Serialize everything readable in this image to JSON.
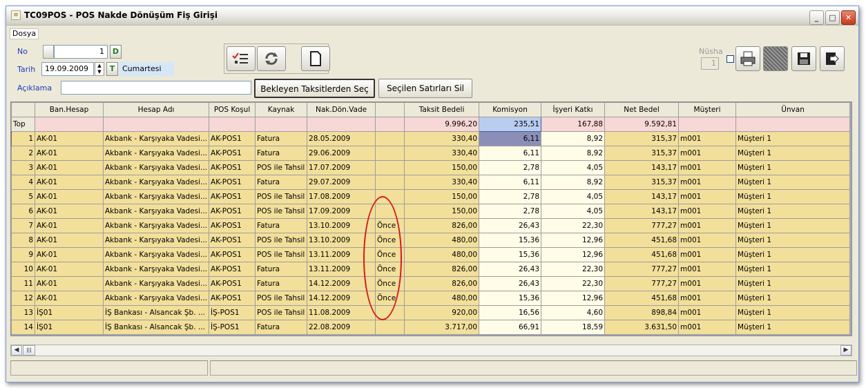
{
  "window": {
    "title": "TC09POS - POS Nakde Dönüşüm Fiş Girişi",
    "app_icon": "document-icon",
    "controls": {
      "minimize": "_",
      "maximize": "□",
      "close": "✕"
    }
  },
  "menu": {
    "items": [
      "Dosya"
    ]
  },
  "form": {
    "no_label": "No",
    "no_value": "1",
    "no_button": "D",
    "tarih_label": "Tarih",
    "tarih_value": "19.09.2009",
    "today_button": "T",
    "day_name": "Cumartesi",
    "aciklama_label": "Açıklama",
    "aciklama_value": "",
    "bekleyen_button": "Bekleyen Taksitlerden Seç",
    "secilen_sil_button": "Seçilen Satırları Sil",
    "nusha_label": "Nüsha",
    "nusha_value": "1"
  },
  "toolbar": {
    "left_icons": [
      "checklist-icon",
      "refresh-icon",
      "new-document-icon"
    ],
    "right_icons": [
      "print-icon",
      "grid-icon",
      "save-icon",
      "exit-icon"
    ]
  },
  "grid": {
    "columns": [
      "",
      "Ban.Hesap",
      "Hesap Adı",
      "POS Koşul",
      "Kaynak",
      "Nak.Dön.Vade",
      "",
      "Taksit Bedeli",
      "Komisyon",
      "İşyeri Katkı",
      "Net Bedel",
      "Müşteri",
      "Ünvan"
    ],
    "top_row": {
      "label": "Top",
      "taksit": "9.996,20",
      "komisyon": "235,51",
      "katki": "167,88",
      "net": "9.592,81"
    },
    "rows": [
      [
        "1",
        "AK-01",
        "Akbank - Karşıyaka Vadesi...",
        "AK-POS1",
        "Fatura",
        "28.05.2009",
        "",
        "330,40",
        "6,11",
        "8,92",
        "315,37",
        "m001",
        "Müşteri 1"
      ],
      [
        "2",
        "AK-01",
        "Akbank - Karşıyaka Vadesi...",
        "AK-POS1",
        "Fatura",
        "29.06.2009",
        "",
        "330,40",
        "6,11",
        "8,92",
        "315,37",
        "m001",
        "Müşteri 1"
      ],
      [
        "3",
        "AK-01",
        "Akbank - Karşıyaka Vadesi...",
        "AK-POS1",
        "POS ile Tahsil",
        "17.07.2009",
        "",
        "150,00",
        "2,78",
        "4,05",
        "143,17",
        "m001",
        "Müşteri 1"
      ],
      [
        "4",
        "AK-01",
        "Akbank - Karşıyaka Vadesi...",
        "AK-POS1",
        "Fatura",
        "29.07.2009",
        "",
        "330,40",
        "6,11",
        "8,92",
        "315,37",
        "m001",
        "Müşteri 1"
      ],
      [
        "5",
        "AK-01",
        "Akbank - Karşıyaka Vadesi...",
        "AK-POS1",
        "POS ile Tahsil",
        "17.08.2009",
        "",
        "150,00",
        "2,78",
        "4,05",
        "143,17",
        "m001",
        "Müşteri 1"
      ],
      [
        "6",
        "AK-01",
        "Akbank - Karşıyaka Vadesi...",
        "AK-POS1",
        "POS ile Tahsil",
        "17.09.2009",
        "",
        "150,00",
        "2,78",
        "4,05",
        "143,17",
        "m001",
        "Müşteri 1"
      ],
      [
        "7",
        "AK-01",
        "Akbank - Karşıyaka Vadesi...",
        "AK-POS1",
        "Fatura",
        "13.10.2009",
        "Önce",
        "826,00",
        "26,43",
        "22,30",
        "777,27",
        "m001",
        "Müşteri 1"
      ],
      [
        "8",
        "AK-01",
        "Akbank - Karşıyaka Vadesi...",
        "AK-POS1",
        "POS ile Tahsil",
        "13.10.2009",
        "Önce",
        "480,00",
        "15,36",
        "12,96",
        "451,68",
        "m001",
        "Müşteri 1"
      ],
      [
        "9",
        "AK-01",
        "Akbank - Karşıyaka Vadesi...",
        "AK-POS1",
        "POS ile Tahsil",
        "13.11.2009",
        "Önce",
        "480,00",
        "15,36",
        "12,96",
        "451,68",
        "m001",
        "Müşteri 1"
      ],
      [
        "10",
        "AK-01",
        "Akbank - Karşıyaka Vadesi...",
        "AK-POS1",
        "Fatura",
        "13.11.2009",
        "Önce",
        "826,00",
        "26,43",
        "22,30",
        "777,27",
        "m001",
        "Müşteri 1"
      ],
      [
        "11",
        "AK-01",
        "Akbank - Karşıyaka Vadesi...",
        "AK-POS1",
        "Fatura",
        "14.12.2009",
        "Önce",
        "826,00",
        "26,43",
        "22,30",
        "777,27",
        "m001",
        "Müşteri 1"
      ],
      [
        "12",
        "AK-01",
        "Akbank - Karşıyaka Vadesi...",
        "AK-POS1",
        "POS ile Tahsil",
        "14.12.2009",
        "Önce",
        "480,00",
        "15,36",
        "12,96",
        "451,68",
        "m001",
        "Müşteri 1"
      ],
      [
        "13",
        "İŞ01",
        "İŞ Bankası - Alsancak Şb. ...",
        "İŞ-POS1",
        "POS ile Tahsil",
        "11.08.2009",
        "",
        "920,00",
        "16,56",
        "4,60",
        "898,84",
        "m001",
        "Müşteri 1"
      ],
      [
        "14",
        "İŞ01",
        "İŞ Bankası - Alsancak Şb. ...",
        "İŞ-POS1",
        "Fatura",
        "22.08.2009",
        "",
        "3.717,00",
        "66,91",
        "18,59",
        "3.631,50",
        "m001",
        "Müşteri 1"
      ]
    ]
  },
  "colors": {
    "row_bg": "#f2df9a",
    "top_row_bg": "#f7d8d6",
    "grid_empty_bg": "#a7a8bf",
    "highlight_ellipse": "#d51a1a",
    "label_blue": "#1a3bbf"
  }
}
